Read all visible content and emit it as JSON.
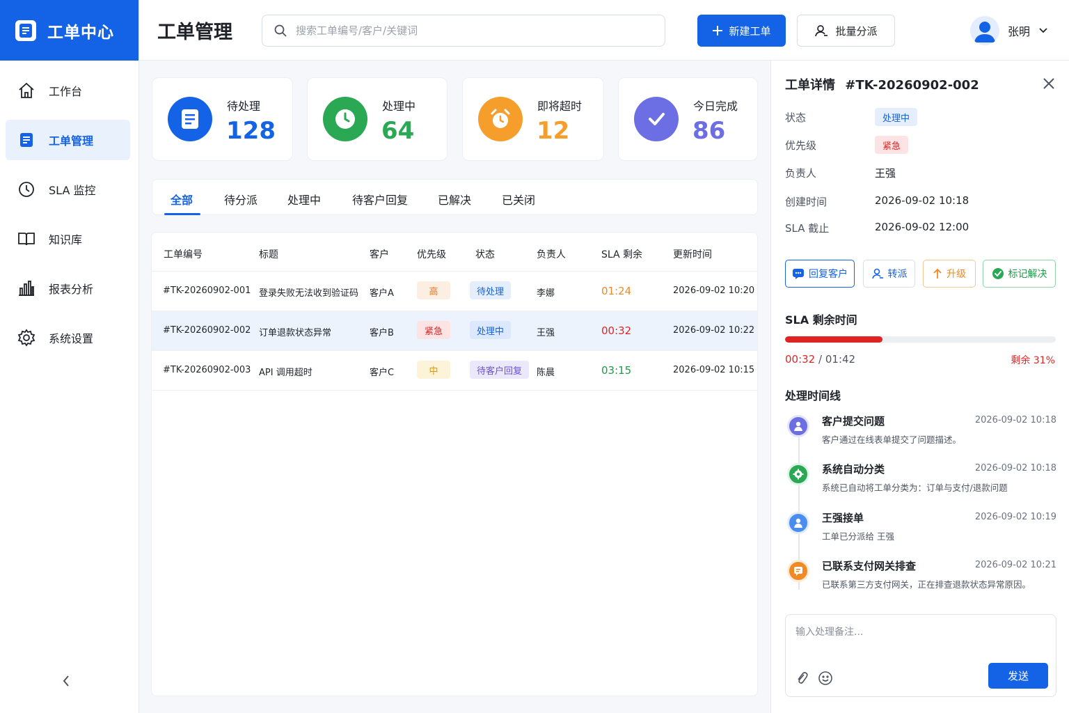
{
  "brand": {
    "title": "工单中心"
  },
  "sidebar": {
    "items": [
      {
        "label": "工作台",
        "icon": "home-icon"
      },
      {
        "label": "工单管理",
        "icon": "ticket-icon"
      },
      {
        "label": "SLA 监控",
        "icon": "clock-icon"
      },
      {
        "label": "知识库",
        "icon": "book-icon"
      },
      {
        "label": "报表分析",
        "icon": "bar-chart-icon"
      },
      {
        "label": "系统设置",
        "icon": "gear-icon"
      }
    ],
    "active_index": 1
  },
  "header": {
    "title": "工单管理",
    "search_placeholder": "搜索工单编号/客户/关键词",
    "new_button": "新建工单",
    "batch_button": "批量分派",
    "user_name": "张明"
  },
  "stats": [
    {
      "label": "待处理",
      "value": "128",
      "color": "#1463e6"
    },
    {
      "label": "处理中",
      "value": "64",
      "color": "#2aa853"
    },
    {
      "label": "即将超时",
      "value": "12",
      "color": "#f59e2b"
    },
    {
      "label": "今日完成",
      "value": "86",
      "color": "#6b6fe3"
    }
  ],
  "tabs": [
    "全部",
    "待分派",
    "处理中",
    "待客户回复",
    "已解决",
    "已关闭"
  ],
  "table": {
    "headers": [
      "工单编号",
      "标题",
      "客户",
      "优先级",
      "状态",
      "负责人",
      "SLA 剩余",
      "更新时间"
    ],
    "rows": [
      {
        "id": "#TK-20260902-001",
        "title": "登录失败无法收到验证码",
        "customer": "客户A",
        "priority": "高",
        "status": "待处理",
        "owner": "李娜",
        "sla": "01:24",
        "updated": "2026-09-02 10:20"
      },
      {
        "id": "#TK-20260902-002",
        "title": "订单退款状态异常",
        "customer": "客户B",
        "priority": "紧急",
        "status": "处理中",
        "owner": "王强",
        "sla": "00:32",
        "updated": "2026-09-02 10:22"
      },
      {
        "id": "#TK-20260902-003",
        "title": "API 调用超时",
        "customer": "客户C",
        "priority": "中",
        "status": "待客户回复",
        "owner": "陈晨",
        "sla": "03:15",
        "updated": "2026-09-02 10:15"
      }
    ]
  },
  "detail": {
    "title": "工单详情",
    "ticket_id": "#TK-20260902-002",
    "fields": {
      "status_label": "状态",
      "status": "处理中",
      "priority_label": "优先级",
      "priority": "紧急",
      "owner_label": "负责人",
      "owner": "王强",
      "created_label": "创建时间",
      "created": "2026-09-02 10:18",
      "sla_label": "SLA 截止",
      "sla_deadline": "2026-09-02 12:00"
    },
    "actions": {
      "reply": "回复客户",
      "transfer": "转派",
      "escalate": "升级",
      "resolve": "标记解决"
    },
    "sla_section": {
      "title": "SLA 剩余时间",
      "elapsed": "00:32",
      "separator": "/",
      "total": "01:42",
      "remaining_text": "剩余 31%",
      "remaining_fraction": 0.36
    },
    "timeline_title": "处理时间线",
    "timeline": [
      {
        "title": "客户提交问题",
        "time": "2026-09-02  10:18",
        "desc": "客户通过在线表单提交了问题描述。",
        "icon": "user-icon",
        "color": "#6b6fe3"
      },
      {
        "title": "系统自动分类",
        "time": "2026-09-02  10:18",
        "desc": "系统已自动将工单分类为：订单与支付/退款问题",
        "icon": "gear-icon",
        "color": "#2aa853"
      },
      {
        "title": "王强接单",
        "time": "2026-09-02  10:19",
        "desc": "工单已分派给  王强",
        "icon": "user-icon",
        "color": "#4a8df0"
      },
      {
        "title": "已联系支付网关排查",
        "time": "2026-09-02  10:21",
        "desc": "已联系第三方支付网关，正在排查退款状态异常原因。",
        "icon": "message-icon",
        "color": "#f08a24"
      }
    ],
    "note_placeholder": "输入处理备注...",
    "send_button": "发送"
  }
}
